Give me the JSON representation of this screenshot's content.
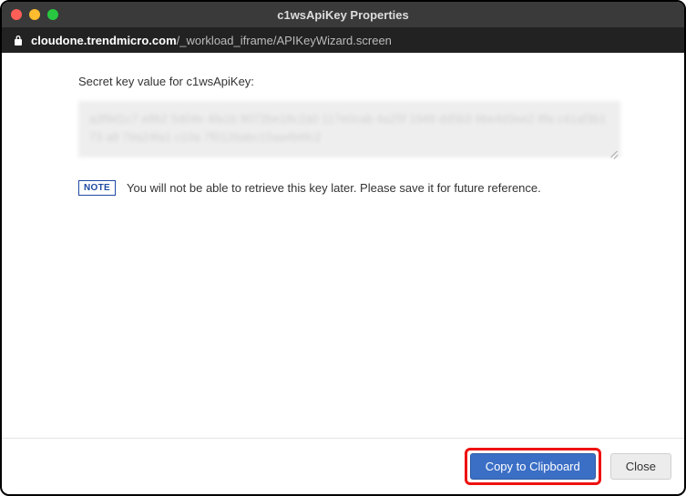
{
  "window": {
    "title": "c1wsApiKey Properties"
  },
  "address": {
    "domain": "cloudone.trendmicro.com",
    "path": "/_workload_iframe/APIKeyWizard.screen"
  },
  "main": {
    "label": "Secret key value for c1wsApiKey:",
    "secret_value_obscured": "a3f9d1c7 e8b2 5d04e 4fa1b 9072be18c2a0 117e0cab 4a25f 1948 dd5b3 9be4d3ee2 8fa c41af3b1 73 a8 79a24fa1 c10a 7f0126abc15aa4b6fc2",
    "note_badge": "NOTE",
    "note_text": "You will not be able to retrieve this key later. Please save it for future reference."
  },
  "footer": {
    "copy_label": "Copy to Clipboard",
    "close_label": "Close"
  }
}
